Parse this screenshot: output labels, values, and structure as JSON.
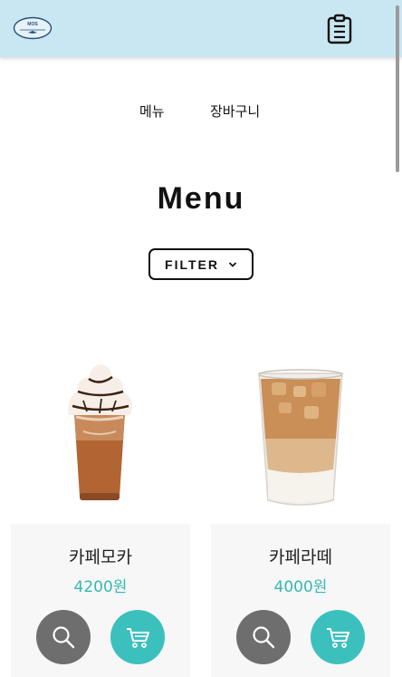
{
  "header": {
    "logo_text": "MOS",
    "logo_icon": "logo-badge",
    "clipboard_icon": "clipboard-icon"
  },
  "nav": {
    "items": [
      {
        "label": "메뉴"
      },
      {
        "label": "장바구니"
      }
    ]
  },
  "page": {
    "title": "Menu"
  },
  "filter": {
    "label": "FILTER",
    "icon": "chevron-down-icon"
  },
  "products": [
    {
      "name": "카페모카",
      "price": "4200원",
      "image": "iced-mocha-with-whipped-cream"
    },
    {
      "name": "카페라떼",
      "price": "4000원",
      "image": "iced-latte"
    }
  ],
  "colors": {
    "header_bg": "#c9e7f3",
    "price": "#35b8b5",
    "search_button": "#6e6e6e",
    "cart_button": "#3cc0be",
    "card_bg": "#f7f7f7"
  }
}
